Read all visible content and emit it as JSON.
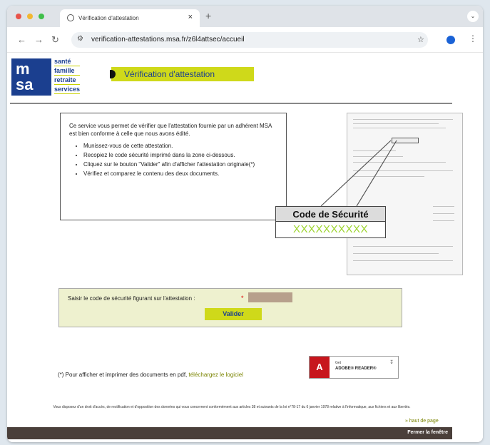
{
  "browser": {
    "tab_title": "Vérification d'attestation",
    "tab_close": "×",
    "new_tab": "+",
    "url": "verification-attestations.msa.fr/z6l4attsec/accueil",
    "colors": {
      "close": "#e8534a",
      "minimize": "#f2b731",
      "maximize": "#3fbf4a"
    }
  },
  "logo": {
    "mark_line1": "m",
    "mark_line2": "sa",
    "words": [
      "santé",
      "famille",
      "retraite",
      "services"
    ]
  },
  "page_title": "Vérification d'attestation",
  "info": {
    "intro": "Ce service vous permet de vérifier que l'attestation fournie par un adhérent MSA est bien conforme à celle que nous avons édité.",
    "steps": [
      "Munissez-vous de cette attestation.",
      "Recopiez le code sécurité imprimé dans la zone ci-dessous.",
      "Cliquez sur le bouton \"Valider\" afin d'afficher l'attestation originale(*)",
      "Vérifiez et comparez le contenu des deux documents."
    ]
  },
  "security": {
    "header": "Code de Sécurité",
    "code": "XXXXXXXXXX"
  },
  "form": {
    "label": "Saisir le code de sécurité figurant sur l'attestation :",
    "required_mark": "*",
    "input_value": "",
    "submit": "Valider"
  },
  "pdf": {
    "text": "(*) Pour afficher et imprimer des documents en pdf,",
    "link": "téléchargez le logiciel",
    "badge_small": "Get",
    "badge_big": "ADOBE® READER®"
  },
  "legal": "Vous disposez d'un droit d'accès, de rectification et d'opposition des données qui vous concernent conformément aux articles 38 et suivants de la loi n°78-17 du 6 janvier 1978 relative à l'informatique, aux fichiers et aux libertés.",
  "back_to_top": "» haut de page",
  "close_window": "Fermer la fenêtre",
  "colors": {
    "brand_blue": "#1b3f8f",
    "accent_yellow": "#cfd91a",
    "form_bg": "#eef1cf",
    "footer": "#4a3f3a"
  }
}
